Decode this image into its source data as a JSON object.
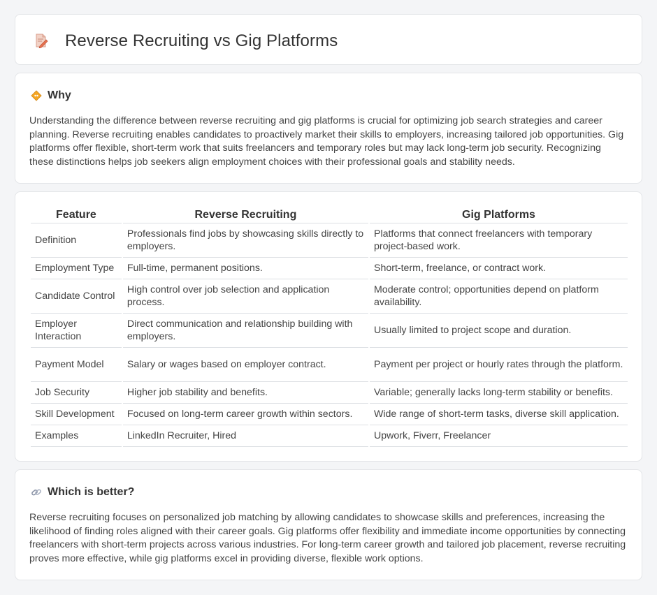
{
  "header": {
    "title": "Reverse Recruiting vs Gig Platforms",
    "icon": "document-pencil-icon"
  },
  "why": {
    "heading": "Why",
    "icon": "diamond-signal-icon",
    "body": "Understanding the difference between reverse recruiting and gig platforms is crucial for optimizing job search strategies and career planning. Reverse recruiting enables candidates to proactively market their skills to employers, increasing tailored job opportunities. Gig platforms offer flexible, short-term work that suits freelancers and temporary roles but may lack long-term job security. Recognizing these distinctions helps job seekers align employment choices with their professional goals and stability needs."
  },
  "table": {
    "headers": [
      "Feature",
      "Reverse Recruiting",
      "Gig Platforms"
    ],
    "rows": [
      [
        "Definition",
        "Professionals find jobs by showcasing skills directly to employers.",
        "Platforms that connect freelancers with temporary project-based work."
      ],
      [
        "Employment Type",
        "Full-time, permanent positions.",
        "Short-term, freelance, or contract work."
      ],
      [
        "Candidate Control",
        "High control over job selection and application process.",
        "Moderate control; opportunities depend on platform availability."
      ],
      [
        "Employer Interaction",
        "Direct communication and relationship building with employers.",
        "Usually limited to project scope and duration."
      ],
      [
        "Payment Model",
        "Salary or wages based on employer contract.",
        "Payment per project or hourly rates through the platform."
      ],
      [
        "Job Security",
        "Higher job stability and benefits.",
        "Variable; generally lacks long-term stability or benefits."
      ],
      [
        "Skill Development",
        "Focused on long-term career growth within sectors.",
        "Wide range of short-term tasks, diverse skill application."
      ],
      [
        "Examples",
        "LinkedIn Recruiter, Hired",
        "Upwork, Fiverr, Freelancer"
      ]
    ]
  },
  "better": {
    "heading": "Which is better?",
    "icon": "link-icon",
    "body": "Reverse recruiting focuses on personalized job matching by allowing candidates to showcase skills and preferences, increasing the likelihood of finding roles aligned with their career goals. Gig platforms offer flexibility and immediate income opportunities by connecting freelancers with short-term projects across various industries. For long-term career growth and tailored job placement, reverse recruiting proves more effective, while gig platforms excel in providing diverse, flexible work options."
  }
}
